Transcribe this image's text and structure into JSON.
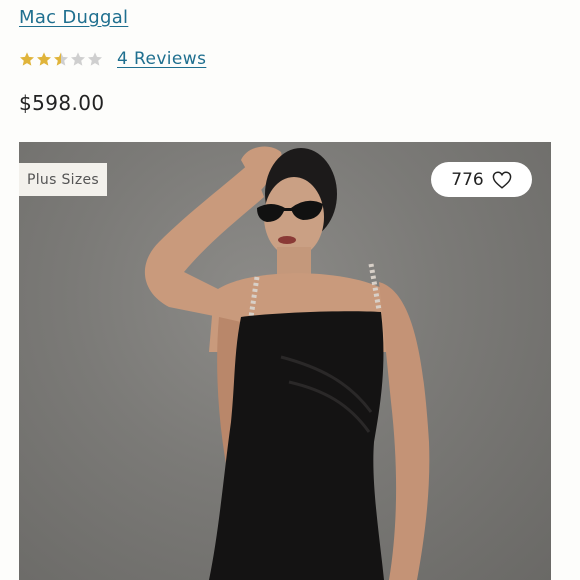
{
  "product": {
    "brand": "Mac Duggal",
    "rating": 2.5,
    "rating_max": 5,
    "reviews_label": "4 Reviews",
    "price": "$598.00"
  },
  "image": {
    "badge": "Plus Sizes",
    "favorites_count": "776"
  },
  "colors": {
    "link": "#1f6f8f",
    "star_filled": "#e0b43a",
    "star_empty": "#cfcfcf"
  },
  "icons": {
    "favorite": "heart-outline-icon",
    "rating": "star-icon"
  }
}
